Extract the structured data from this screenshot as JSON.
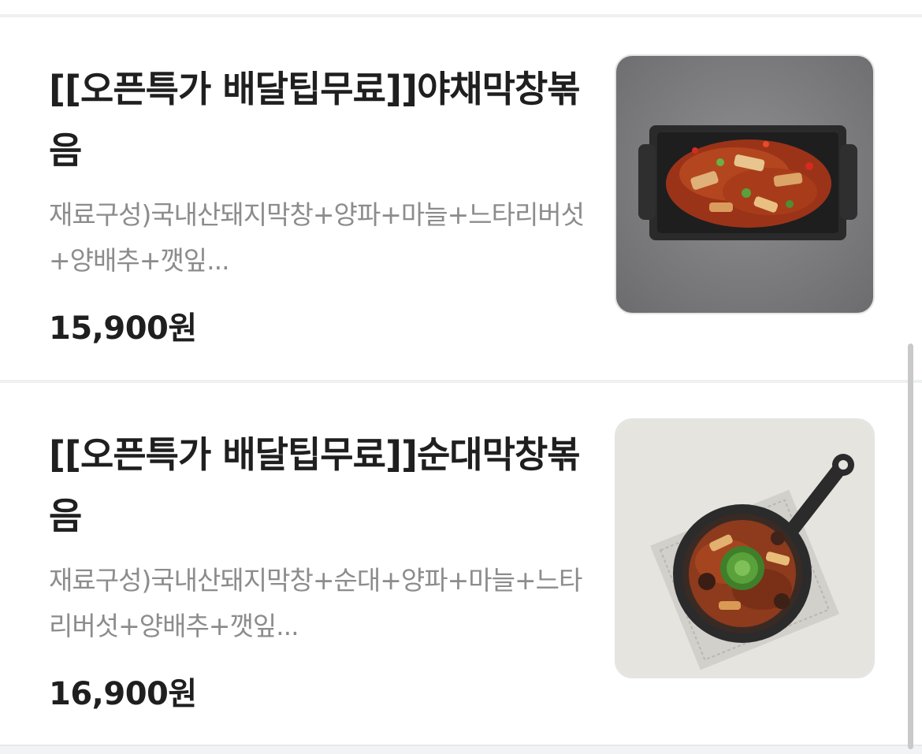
{
  "menu": {
    "items": [
      {
        "name": "[[오픈특가 배달팁무료]]야채막창볶음",
        "description": "재료구성)국내산돼지막창+양파+마늘+느타리버섯+양배추+깻잎...",
        "price": "15,900원",
        "image_icon": "stir-fried-pork-intestine-dish-photo"
      },
      {
        "name": "[[오픈특가 배달팁무료]]순대막창볶음",
        "description": "재료구성)국내산돼지막창+순대+양파+마늘+느타리버섯+양배추+깻잎...",
        "price": "16,900원",
        "image_icon": "pork-intestine-sundae-skillet-photo"
      }
    ]
  }
}
